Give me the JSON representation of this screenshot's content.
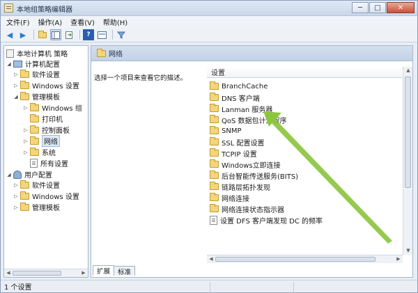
{
  "window": {
    "title": "本地组策略编辑器",
    "controls": {
      "minimize": "─",
      "maximize": "□",
      "close": "✕"
    }
  },
  "menu": [
    "文件(F)",
    "操作(A)",
    "查看(V)",
    "帮助(H)"
  ],
  "toolbar": {
    "icons": [
      "back-arrow-icon",
      "forward-arrow-icon",
      "up-folder-icon",
      "show-hide-tree-icon",
      "export-list-icon",
      "help-icon",
      "properties-icon",
      "filter-icon"
    ],
    "help_glyph": "?"
  },
  "tree": {
    "root": "本地计算机 策略",
    "computer_config": "计算机配置",
    "computer_children": [
      "软件设置",
      "Windows 设置",
      "管理模板"
    ],
    "admin_templates_children": [
      "Windows 组",
      "打印机",
      "控制面板",
      "网络",
      "系统",
      "所有设置"
    ],
    "user_config": "用户配置",
    "user_children": [
      "软件设置",
      "Windows 设置",
      "管理模板"
    ],
    "selected": "网络"
  },
  "right_pane": {
    "header": "网络",
    "description": "选择一个项目来查看它的描述。",
    "column_header": "设置",
    "items": [
      "BranchCache",
      "DNS 客户端",
      "Lanman 服务器",
      "QoS 数据包计划程序",
      "SNMP",
      "SSL 配置设置",
      "TCPIP 设置",
      "Windows立即连接",
      "后台智能传送服务(BITS)",
      "链路层拓扑发现",
      "网络连接",
      "网络连接状态指示器",
      "设置 DFS 客户端发现 DC 的频率"
    ],
    "tabs": [
      "扩展",
      "标准"
    ],
    "active_tab": "扩展"
  },
  "status": {
    "text": "1 个设置"
  },
  "colors": {
    "annotation_arrow": "#8cc63f",
    "selection": "#dce8f7",
    "folder": "#f3d57b"
  }
}
